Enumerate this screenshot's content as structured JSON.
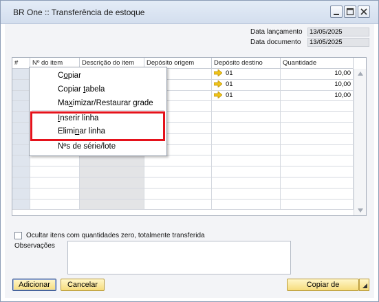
{
  "window": {
    "title": "BR One :: Transferência de estoque"
  },
  "header_fields": {
    "data_lancamento": {
      "label": "Data lançamento",
      "value": "13/05/2025"
    },
    "data_documento": {
      "label": "Data documento",
      "value": "13/05/2025"
    }
  },
  "grid": {
    "columns": [
      "#",
      "Nº do item",
      "Descrição do item",
      "Depósito origem",
      "Depósito destino",
      "Quantidade"
    ],
    "rows": [
      {
        "deposito_destino": "01",
        "quantidade": "10,00"
      },
      {
        "deposito_destino": "01",
        "quantidade": "10,00"
      },
      {
        "deposito_destino": "01",
        "quantidade": "10,00"
      }
    ]
  },
  "context_menu": {
    "items": [
      {
        "pre": "C",
        "ul": "o",
        "post": "piar"
      },
      {
        "pre": "Copiar ",
        "ul": "t",
        "post": "abela"
      },
      {
        "pre": "Ma",
        "ul": "x",
        "post": "imizar/Restaurar grade"
      },
      {
        "pre": "",
        "ul": "I",
        "post": "nserir linha"
      },
      {
        "pre": "Elimi",
        "ul": "n",
        "post": "ar linha"
      },
      {
        "pre": "Nºs de série/lote",
        "ul": "",
        "post": ""
      }
    ]
  },
  "footer": {
    "hide_zero_label": "Ocultar itens com quantidades zero, totalmente transferida",
    "observacoes_label": "Observações",
    "observacoes_value": "",
    "add_button": "Adicionar",
    "cancel_button": "Cancelar",
    "copy_from_button": "Copiar de"
  },
  "colors": {
    "highlight": "#e5121b",
    "button_face": "#f6dc7c",
    "arrow": "#f0c419"
  }
}
